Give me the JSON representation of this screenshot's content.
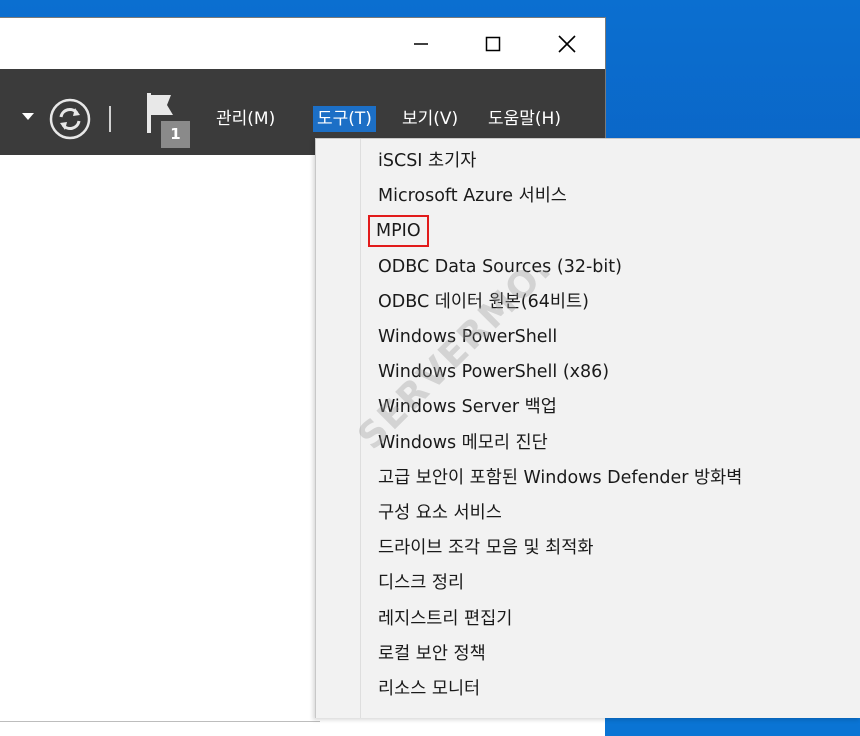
{
  "window": {
    "controls": {
      "minimize": "minimize",
      "maximize": "maximize",
      "close": "close"
    }
  },
  "toolbar": {
    "notification_count": "1",
    "menu": {
      "manage": "관리(M)",
      "tools": "도구(T)",
      "view": "보기(V)",
      "help": "도움말(H)"
    }
  },
  "tools_menu": {
    "items": [
      "iSCSI 초기자",
      "Microsoft Azure 서비스",
      "MPIO",
      "ODBC Data Sources (32-bit)",
      "ODBC 데이터 원본(64비트)",
      "Windows PowerShell",
      "Windows PowerShell (x86)",
      "Windows Server 백업",
      "Windows 메모리 진단",
      "고급 보안이 포함된 Windows Defender 방화벽",
      "구성 요소 서비스",
      "드라이브 조각 모음 및 최적화",
      "디스크 정리",
      "레지스트리 편집기",
      "로컬 보안 정책",
      "리소스 모니터"
    ],
    "highlighted_index": 2
  },
  "watermark": {
    "text": "SERVERMON"
  },
  "colors": {
    "toolbar_bg": "#3b3b3b",
    "active_menu": "#1c6fc6",
    "highlight_box": "#e21b1b",
    "desktop": "#0a5fc0"
  }
}
